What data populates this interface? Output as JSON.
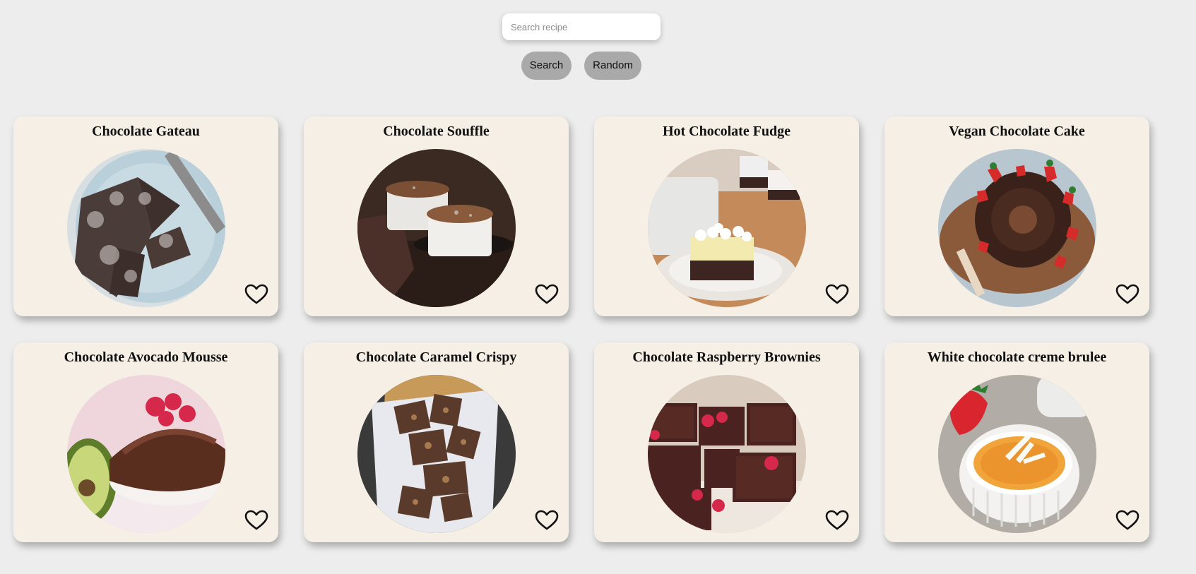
{
  "search": {
    "placeholder": "Search recipe",
    "value": ""
  },
  "buttons": {
    "search_label": "Search",
    "random_label": "Random"
  },
  "colors": {
    "page_background": "#ededed",
    "card_background": "#f5efe6",
    "button_background": "#a9a9a9"
  },
  "recipes": [
    {
      "title": "Chocolate Gateau",
      "image": "chocolate-gateau-photo",
      "favorite_icon": "heart-outline-icon"
    },
    {
      "title": "Chocolate Souffle",
      "image": "chocolate-souffle-photo",
      "favorite_icon": "heart-outline-icon"
    },
    {
      "title": "Hot Chocolate Fudge",
      "image": "hot-chocolate-fudge-photo",
      "favorite_icon": "heart-outline-icon"
    },
    {
      "title": "Vegan Chocolate Cake",
      "image": "vegan-chocolate-cake-photo",
      "favorite_icon": "heart-outline-icon"
    },
    {
      "title": "Chocolate Avocado Mousse",
      "image": "chocolate-avocado-mousse-photo",
      "favorite_icon": "heart-outline-icon"
    },
    {
      "title": "Chocolate Caramel Crispy",
      "image": "chocolate-caramel-crispy-photo",
      "favorite_icon": "heart-outline-icon"
    },
    {
      "title": "Chocolate Raspberry Brownies",
      "image": "chocolate-raspberry-brownies-photo",
      "favorite_icon": "heart-outline-icon"
    },
    {
      "title": "White chocolate creme brulee",
      "image": "white-chocolate-creme-brulee-photo",
      "favorite_icon": "heart-outline-icon"
    }
  ]
}
